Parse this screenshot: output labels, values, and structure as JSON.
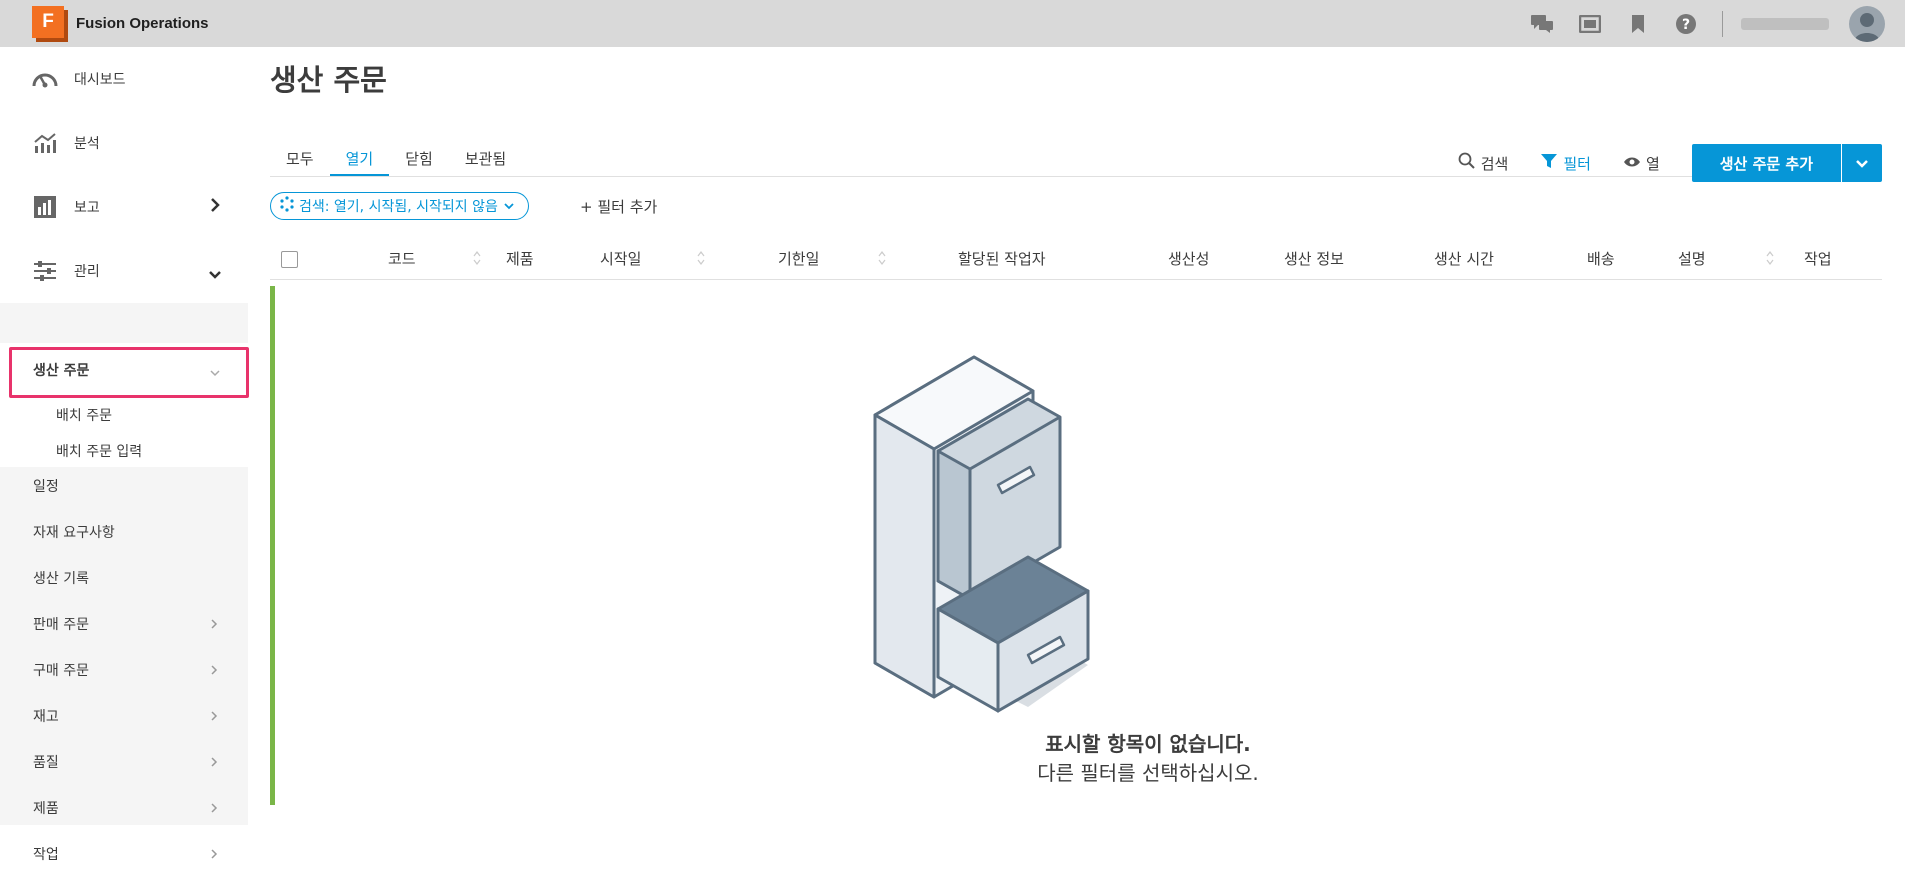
{
  "app": {
    "logo_letter": "F",
    "name": "Fusion Operations",
    "username": ""
  },
  "topbar_icons": [
    "chat-icon",
    "screen-icon",
    "bookmark-icon",
    "help-icon"
  ],
  "sidebar": {
    "top_items": [
      {
        "label": "대시보드",
        "icon": "dashboard-icon"
      },
      {
        "label": "분석",
        "icon": "analytics-icon"
      },
      {
        "label": "보고",
        "icon": "report-icon"
      },
      {
        "label": "관리",
        "icon": "settings-sliders-icon"
      }
    ],
    "active_group": "생산 주문",
    "sub_items": [
      "배치 주문",
      "배치 주문 입력"
    ],
    "items": [
      "일정",
      "자재 요구사항",
      "생산 기록",
      "판매 주문",
      "구매 주문",
      "재고",
      "품질",
      "제품",
      "작업"
    ]
  },
  "page": {
    "title": "생산 주문"
  },
  "tabs": [
    "모두",
    "열기",
    "닫힘",
    "보관됨"
  ],
  "active_tab": "열기",
  "toolbar": {
    "search_label": "검색",
    "filter_label": "필터",
    "columns_label": "열",
    "add_label": "생산 주문 추가"
  },
  "filter_chip": "검색: 열기, 시작됨, 시작되지 않음",
  "add_filter": "+ 필터 추가",
  "columns": [
    "코드",
    "제품",
    "시작일",
    "기한일",
    "할당된 작업자",
    "생산성",
    "생산 정보",
    "생산 시간",
    "배송",
    "설명",
    "작업"
  ],
  "empty_state": {
    "title": "표시할 항목이 없습니다.",
    "subtitle": "다른 필터를 선택하십시오."
  },
  "colors": {
    "accent": "#0696d7",
    "brand": "#f37021",
    "highlight": "#e8336b",
    "status_bar": "#7ab648"
  }
}
